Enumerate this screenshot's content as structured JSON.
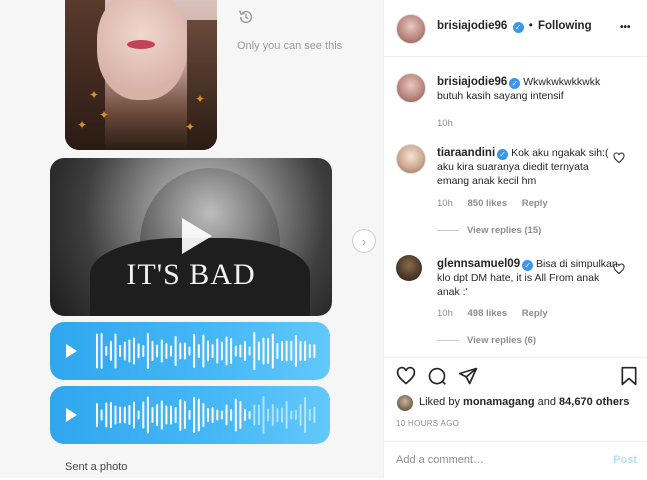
{
  "media": {
    "private_note": "Only you can see this",
    "video_caption": "IT'S BAD",
    "sent_label": "Sent a photo"
  },
  "header": {
    "username": "brisiajodie96",
    "separator": "•",
    "follow_status": "Following",
    "more": "•••"
  },
  "caption": {
    "username": "brisiajodie96",
    "text": "Wkwkwkwkkwkk butuh kasih sayang intensif",
    "time": "10h"
  },
  "comments": [
    {
      "username": "tiaraandini",
      "text": "Kok aku ngakak sih:( aku kira suaranya diedit ternyata emang anak kecil hm",
      "time": "10h",
      "likes": "850 likes",
      "reply": "Reply",
      "view_replies": "View replies (15)"
    },
    {
      "username": "glennsamuel09",
      "text": "Bisa di simpulkan klo dpt DM hate, it is All From anak anak :'",
      "time": "10h",
      "likes": "498 likes",
      "reply": "Reply",
      "view_replies": "View replies (6)"
    }
  ],
  "likes": {
    "prefix": "Liked by",
    "user": "monamagang",
    "middle": "and",
    "count": "84,670 others"
  },
  "timestamp": "10 HOURS AGO",
  "add_comment": {
    "placeholder": "Add a comment…",
    "post_label": "Post"
  },
  "icons": [
    "history-icon",
    "play-icon",
    "chevron-right-icon",
    "verified-icon",
    "more-icon",
    "heart-icon",
    "comment-icon",
    "share-icon",
    "bookmark-icon"
  ],
  "colors": {
    "voice_bubble": "#3aaef2",
    "verified": "#3897f0",
    "post_disabled": "#b2dffc"
  }
}
